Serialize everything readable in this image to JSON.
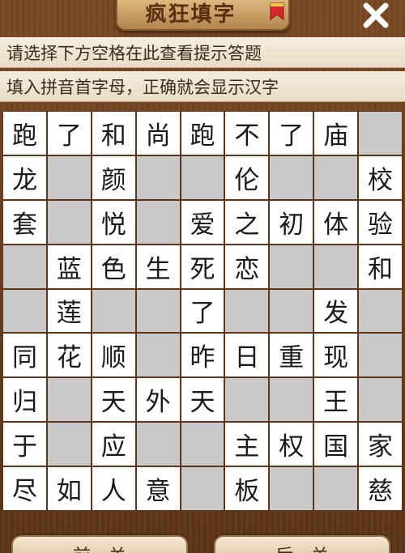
{
  "header": {
    "title": "疯狂填字"
  },
  "hints": {
    "line1": "请选择下方空格在此查看提示答题",
    "line2": "填入拼音首字母，正确就会显示汉字"
  },
  "grid": [
    [
      "跑",
      "了",
      "和",
      "尚",
      "跑",
      "不",
      "了",
      "庙",
      ""
    ],
    [
      "龙",
      "",
      "颜",
      "",
      "",
      "伦",
      "",
      "",
      "校"
    ],
    [
      "套",
      "",
      "悦",
      "",
      "爱",
      "之",
      "初",
      "体",
      "验"
    ],
    [
      "",
      "蓝",
      "色",
      "生",
      "死",
      "恋",
      "",
      "",
      "和"
    ],
    [
      "",
      "莲",
      "",
      "",
      "了",
      "",
      "",
      "发",
      ""
    ],
    [
      "同",
      "花",
      "顺",
      "",
      "昨",
      "日",
      "重",
      "现",
      ""
    ],
    [
      "归",
      "",
      "天",
      "外",
      "天",
      "",
      "",
      "王",
      ""
    ],
    [
      "于",
      "",
      "应",
      "",
      "",
      "主",
      "权",
      "国",
      "家"
    ],
    [
      "尽",
      "如",
      "人",
      "意",
      "",
      "板",
      "",
      "",
      "慈"
    ]
  ],
  "buttons": {
    "prev_label": "前一关",
    "next_label": "后一关"
  },
  "icons": {
    "close": "close-icon",
    "ribbon": "ribbon-icon"
  },
  "colors": {
    "filled_cell": "#ffffff",
    "empty_cell": "#c9c9c9",
    "wood": "#6b3f1f"
  }
}
